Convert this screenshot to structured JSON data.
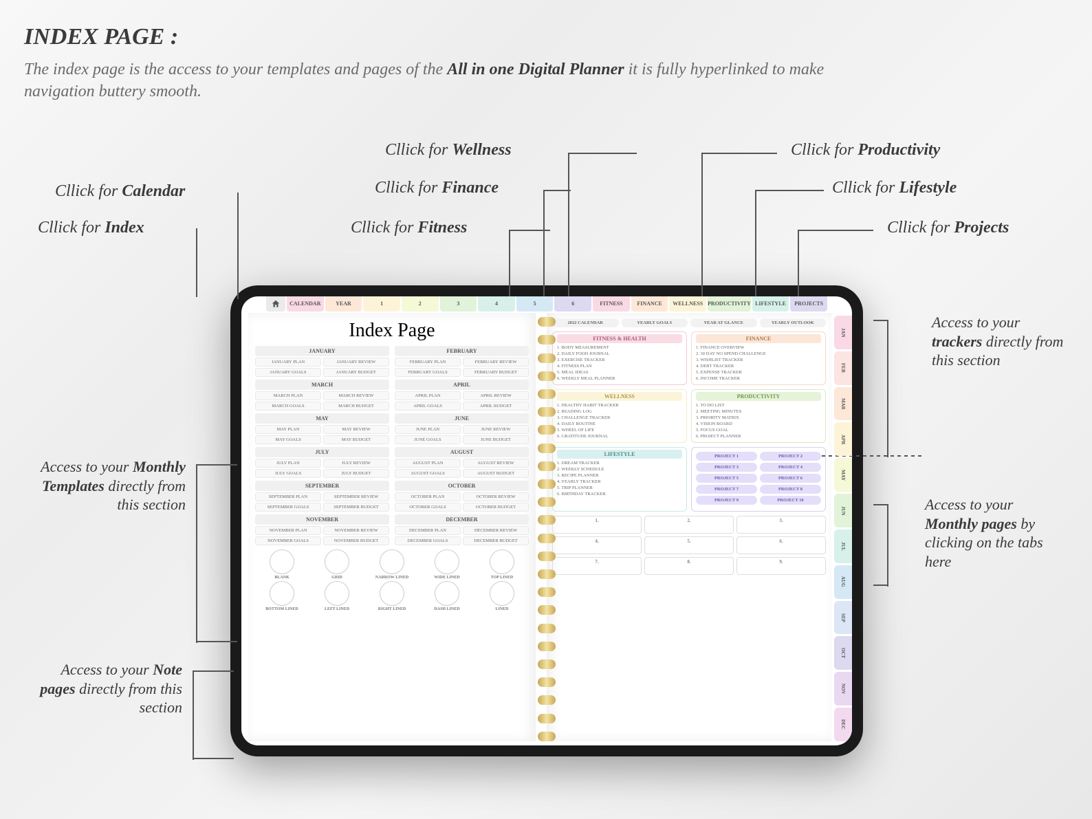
{
  "title": "INDEX PAGE :",
  "desc_pre": "The index page is the access to your templates and pages of the ",
  "desc_bold": "All in one Digital Planner",
  "desc_post": " it is fully hyperlinked to make navigation buttery smooth.",
  "callouts": {
    "calendar": "Cllick for ",
    "calendar_b": "Calendar",
    "index": "Cllick for ",
    "index_b": "Index",
    "fitness": "Cllick for ",
    "fitness_b": "Fitness",
    "finance": "Cllick for ",
    "finance_b": "Finance",
    "wellness": "Cllick for ",
    "wellness_b": "Wellness",
    "productivity": "Cllick for ",
    "productivity_b": "Productivity",
    "lifestyle": "Cllick for ",
    "lifestyle_b": "Lifestyle",
    "projects": "Cllick for ",
    "projects_b": "Projects"
  },
  "side_notes": {
    "monthly_tpl": "Access to your <b>Monthly Templates</b> directly from this section",
    "notes": "Access to your <b>Note pages</b> directly from this section",
    "trackers": "Access to your <b>trackers</b> directly from this section",
    "monthly_pages": "Access to your <b>Monthly pages</b> by clicking on the tabs here"
  },
  "top_tabs": [
    "CALENDAR",
    "YEAR",
    "1",
    "2",
    "3",
    "4",
    "5",
    "6",
    "FITNESS",
    "FINANCE",
    "WELLNESS",
    "PRODUCTIVITY",
    "LIFESTYLE",
    "PROJECTS"
  ],
  "right_tabs": [
    "JAN",
    "FEB",
    "MAR",
    "APR",
    "MAY",
    "JUN",
    "JUL",
    "AUG",
    "SEP",
    "OCT",
    "NOV",
    "DEC"
  ],
  "index_title": "Index Page",
  "months": [
    {
      "name": "JANUARY",
      "b": [
        "JANUARY PLAN",
        "JANUARY REVIEW",
        "JANUARY GOALS",
        "JANUARY BUDGET"
      ]
    },
    {
      "name": "FEBRUARY",
      "b": [
        "FEBRUARY PLAN",
        "FEBRUARY REVIEW",
        "FEBRUARY GOALS",
        "FEBRUARY BUDGET"
      ]
    },
    {
      "name": "MARCH",
      "b": [
        "MARCH PLAN",
        "MARCH REVIEW",
        "MARCH GOALS",
        "MARCH BUDGET"
      ]
    },
    {
      "name": "APRIL",
      "b": [
        "APRIL PLAN",
        "APRIL REVIEW",
        "APRIL GOALS",
        "APRIL BUDGET"
      ]
    },
    {
      "name": "MAY",
      "b": [
        "MAY PLAN",
        "MAY REVIEW",
        "MAY GOALS",
        "MAY BUDGET"
      ]
    },
    {
      "name": "JUNE",
      "b": [
        "JUNE PLAN",
        "JUNE REVIEW",
        "JUNE GOALS",
        "JUNE BUDGET"
      ]
    },
    {
      "name": "JULY",
      "b": [
        "JULY PLAN",
        "JULY REVIEW",
        "JULY GOALS",
        "JULY BUDGET"
      ]
    },
    {
      "name": "AUGUST",
      "b": [
        "AUGUST PLAN",
        "AUGUST REVIEW",
        "AUGUST GOALS",
        "AUGUST BUDGET"
      ]
    },
    {
      "name": "SEPTEMBER",
      "b": [
        "SEPTEMBER PLAN",
        "SEPTEMBER REVIEW",
        "SEPTEMBER GOALS",
        "SEPTEMBER BUDGET"
      ]
    },
    {
      "name": "OCTOBER",
      "b": [
        "OCTOBER PLAN",
        "OCTOBER REVIEW",
        "OCTOBER GOALS",
        "OCTOBER BUDGET"
      ]
    },
    {
      "name": "NOVEMBER",
      "b": [
        "NOVEMBER PLAN",
        "NOVEMBER REVIEW",
        "NOVEMBER GOALS",
        "NOVEMBER BUDGET"
      ]
    },
    {
      "name": "DECEMBER",
      "b": [
        "DECEMBER PLAN",
        "DECEMBER REVIEW",
        "DECEMBER GOALS",
        "DECEMBER BUDGET"
      ]
    }
  ],
  "note_types": [
    "BLANK",
    "GRID",
    "NARROW LINED",
    "WIDE LINED",
    "TOP LINED",
    "BOTTOM LINED",
    "LEFT LINED",
    "RIGHT LINED",
    "DASH LINED",
    "LINED"
  ],
  "pills": [
    "2022 CALENDAR",
    "YEARLY GOALS",
    "YEAR AT GLANCE",
    "YEARLY OUTLOOK"
  ],
  "trackers": {
    "fitness": {
      "title": "FITNESS & HEALTH",
      "items": [
        "1. BODY MEASUREMENT",
        "2. DAILY FOOD JOURNAL",
        "3. EXERCISE TRACKER",
        "4. FITNESS PLAN",
        "5. MEAL IDEAS",
        "6. WEEKLY MEAL PLANNER"
      ]
    },
    "finance": {
      "title": "FINANCE",
      "items": [
        "1. FINANCE OVERVIEW",
        "2. 30 DAY NO SPEND CHALLENGE",
        "3. WISHLIST TRACKER",
        "4. DEBT TRACKER",
        "5. EXPENSE TRACKER",
        "6. INCOME TRACKER"
      ]
    },
    "wellness": {
      "title": "WELLNESS",
      "items": [
        "1. HEALTHY HABIT TRACKER",
        "2. READING LOG",
        "3. CHALLENGE TRACKER",
        "4. DAILY ROUTINE",
        "5. WHEEL OF LIFE",
        "6. GRATITUDE JOURNAL"
      ]
    },
    "productivity": {
      "title": "PRODUCTIVITY",
      "items": [
        "1. TO DO LIST",
        "2. MEETING MINUTES",
        "3. PRIORITY MATRIX",
        "4. VISION BOARD",
        "5. FOCUS GOAL",
        "6. PROJECT PLANNER"
      ]
    },
    "lifestyle": {
      "title": "LIFESTYLE",
      "items": [
        "1. DREAM TRACKER",
        "2. WEEKLY SCHEDULE",
        "3. RECIPE PLANNER",
        "4. YEARLY TRACKER",
        "5. TRIP PLANNER",
        "6. BIRTHDAY TRACKER"
      ]
    }
  },
  "projects": [
    "PROJECT 1",
    "PROJECT 2",
    "PROJECT 3",
    "PROJECT 4",
    "PROJECT 5",
    "PROJECT 6",
    "PROJECT 7",
    "PROJECT 8",
    "PROJECT 9",
    "PROJECT 10"
  ],
  "extras": [
    "1.",
    "2.",
    "3.",
    "4.",
    "5.",
    "6.",
    "7.",
    "8.",
    "9."
  ]
}
